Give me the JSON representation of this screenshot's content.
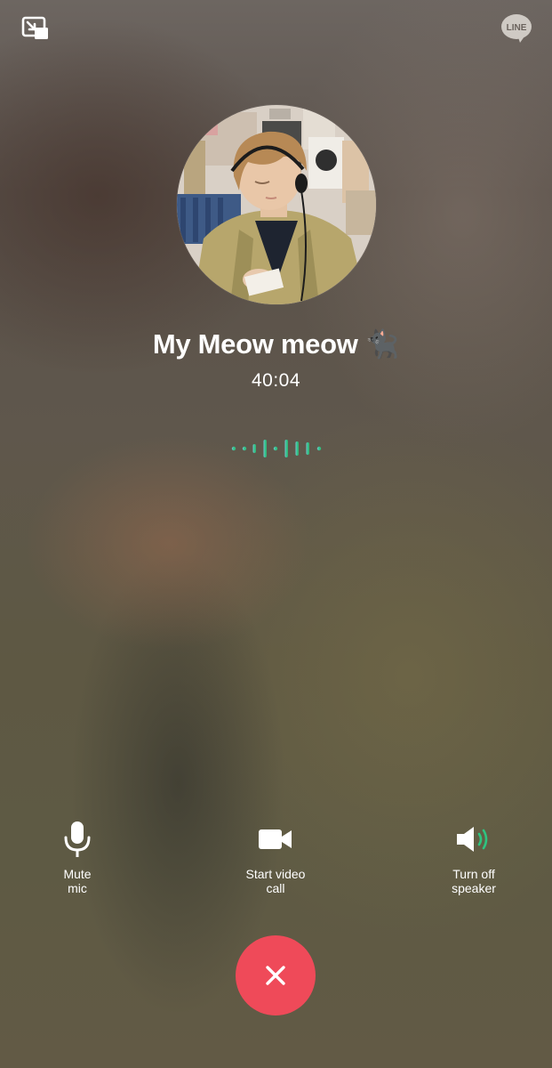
{
  "call": {
    "contact_name": "My Meow meow 🐈‍⬛",
    "duration": "40:04"
  },
  "top_bar": {
    "left_icon": "minimize-window-icon",
    "right_icon": "line-logo-icon",
    "logo_text": "LINE"
  },
  "controls": {
    "mute": {
      "label": "Mute\nmic",
      "icon": "microphone-icon"
    },
    "video": {
      "label": "Start video\ncall",
      "icon": "video-camera-icon"
    },
    "speaker": {
      "label": "Turn off\nspeaker",
      "icon": "speaker-on-icon"
    }
  },
  "end_call": {
    "icon": "close-icon"
  },
  "colors": {
    "end_call": "#ef4a59",
    "wave_accent": "#2ec480",
    "speaker_accent": "#2ec480",
    "text": "#ffffff"
  }
}
